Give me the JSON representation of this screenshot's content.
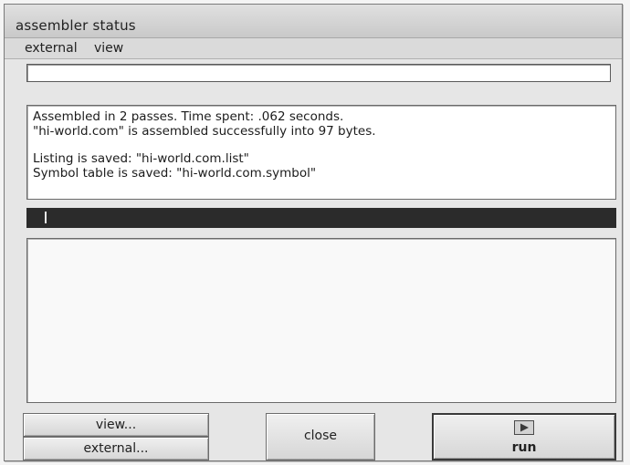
{
  "window": {
    "title": "assembler status"
  },
  "menu": {
    "items": [
      "external",
      "view"
    ]
  },
  "path_field": {
    "value": ""
  },
  "status": {
    "lines": [
      "Assembled in 2 passes. Time spent: .062 seconds.",
      "\"hi-world.com\" is assembled successfully into 97 bytes.",
      "",
      "Listing is saved: \"hi-world.com.list\"",
      "Symbol table is saved: \"hi-world.com.symbol\""
    ]
  },
  "command": {
    "value": ""
  },
  "buttons": {
    "view_label": "view...",
    "external_label": "external...",
    "close_label": "close",
    "run_label": "run",
    "run_icon": "play-icon"
  },
  "colors": {
    "command_bar_bg": "#2b2b2b",
    "window_bg": "#e6e6e6"
  }
}
